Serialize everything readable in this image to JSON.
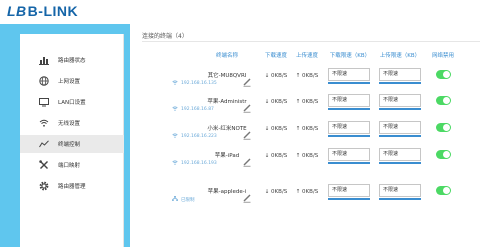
{
  "brand": {
    "name": "B-LINK",
    "mark": "LB"
  },
  "sidebar": {
    "items": [
      {
        "label": "路由器状态",
        "icon": "chart-bars-icon",
        "active": false
      },
      {
        "label": "上网设置",
        "icon": "globe-icon",
        "active": false
      },
      {
        "label": "LAN口设置",
        "icon": "monitor-icon",
        "active": false
      },
      {
        "label": "无线设置",
        "icon": "wifi-icon",
        "active": false
      },
      {
        "label": "终端控制",
        "icon": "trend-line-icon",
        "active": true
      },
      {
        "label": "端口映射",
        "icon": "tools-icon",
        "active": false
      },
      {
        "label": "路由器管理",
        "icon": "gear-icon",
        "active": false
      }
    ]
  },
  "main": {
    "title": "连接的终端（4）",
    "columns": [
      "终端名称",
      "下载速度",
      "上传速度",
      "下载限速（KB）",
      "上传限速（KB）",
      "网络禁用"
    ],
    "devices": [
      {
        "name": "其它-MU8QVRI",
        "ip": "192.168.16.135",
        "conn": "wifi",
        "down": "↓ 0KB/S",
        "up": "↑ 0KB/S",
        "down_limit": "不限速",
        "up_limit": "不限速",
        "enabled": true
      },
      {
        "name": "苹果-Administr",
        "ip": "192.168.16.87",
        "conn": "wifi",
        "down": "↓ 0KB/S",
        "up": "↑ 0KB/S",
        "down_limit": "不限速",
        "up_limit": "不限速",
        "enabled": true
      },
      {
        "name": "小米-红米NOTE",
        "ip": "192.168.16.223",
        "conn": "wifi",
        "down": "↓ 0KB/S",
        "up": "↑ 0KB/S",
        "down_limit": "不限速",
        "up_limit": "不限速",
        "enabled": true
      },
      {
        "name": "苹果-iPad",
        "ip": "192.168.16.193",
        "conn": "wifi",
        "down": "↓ 0KB/S",
        "up": "↑ 0KB/S",
        "down_limit": "不限速",
        "up_limit": "不限速",
        "enabled": true
      },
      {
        "name": "苹果-applede-i",
        "ip": "已限制",
        "conn": "wired",
        "down": "↓ 0KB/S",
        "up": "↑ 0KB/S",
        "down_limit": "不限速",
        "up_limit": "不限速",
        "enabled": true
      }
    ]
  },
  "colors": {
    "accent": "#3a8dd0",
    "background": "#5fc6ee",
    "toggle_on": "#4cd964",
    "brand": "#1565a8"
  }
}
